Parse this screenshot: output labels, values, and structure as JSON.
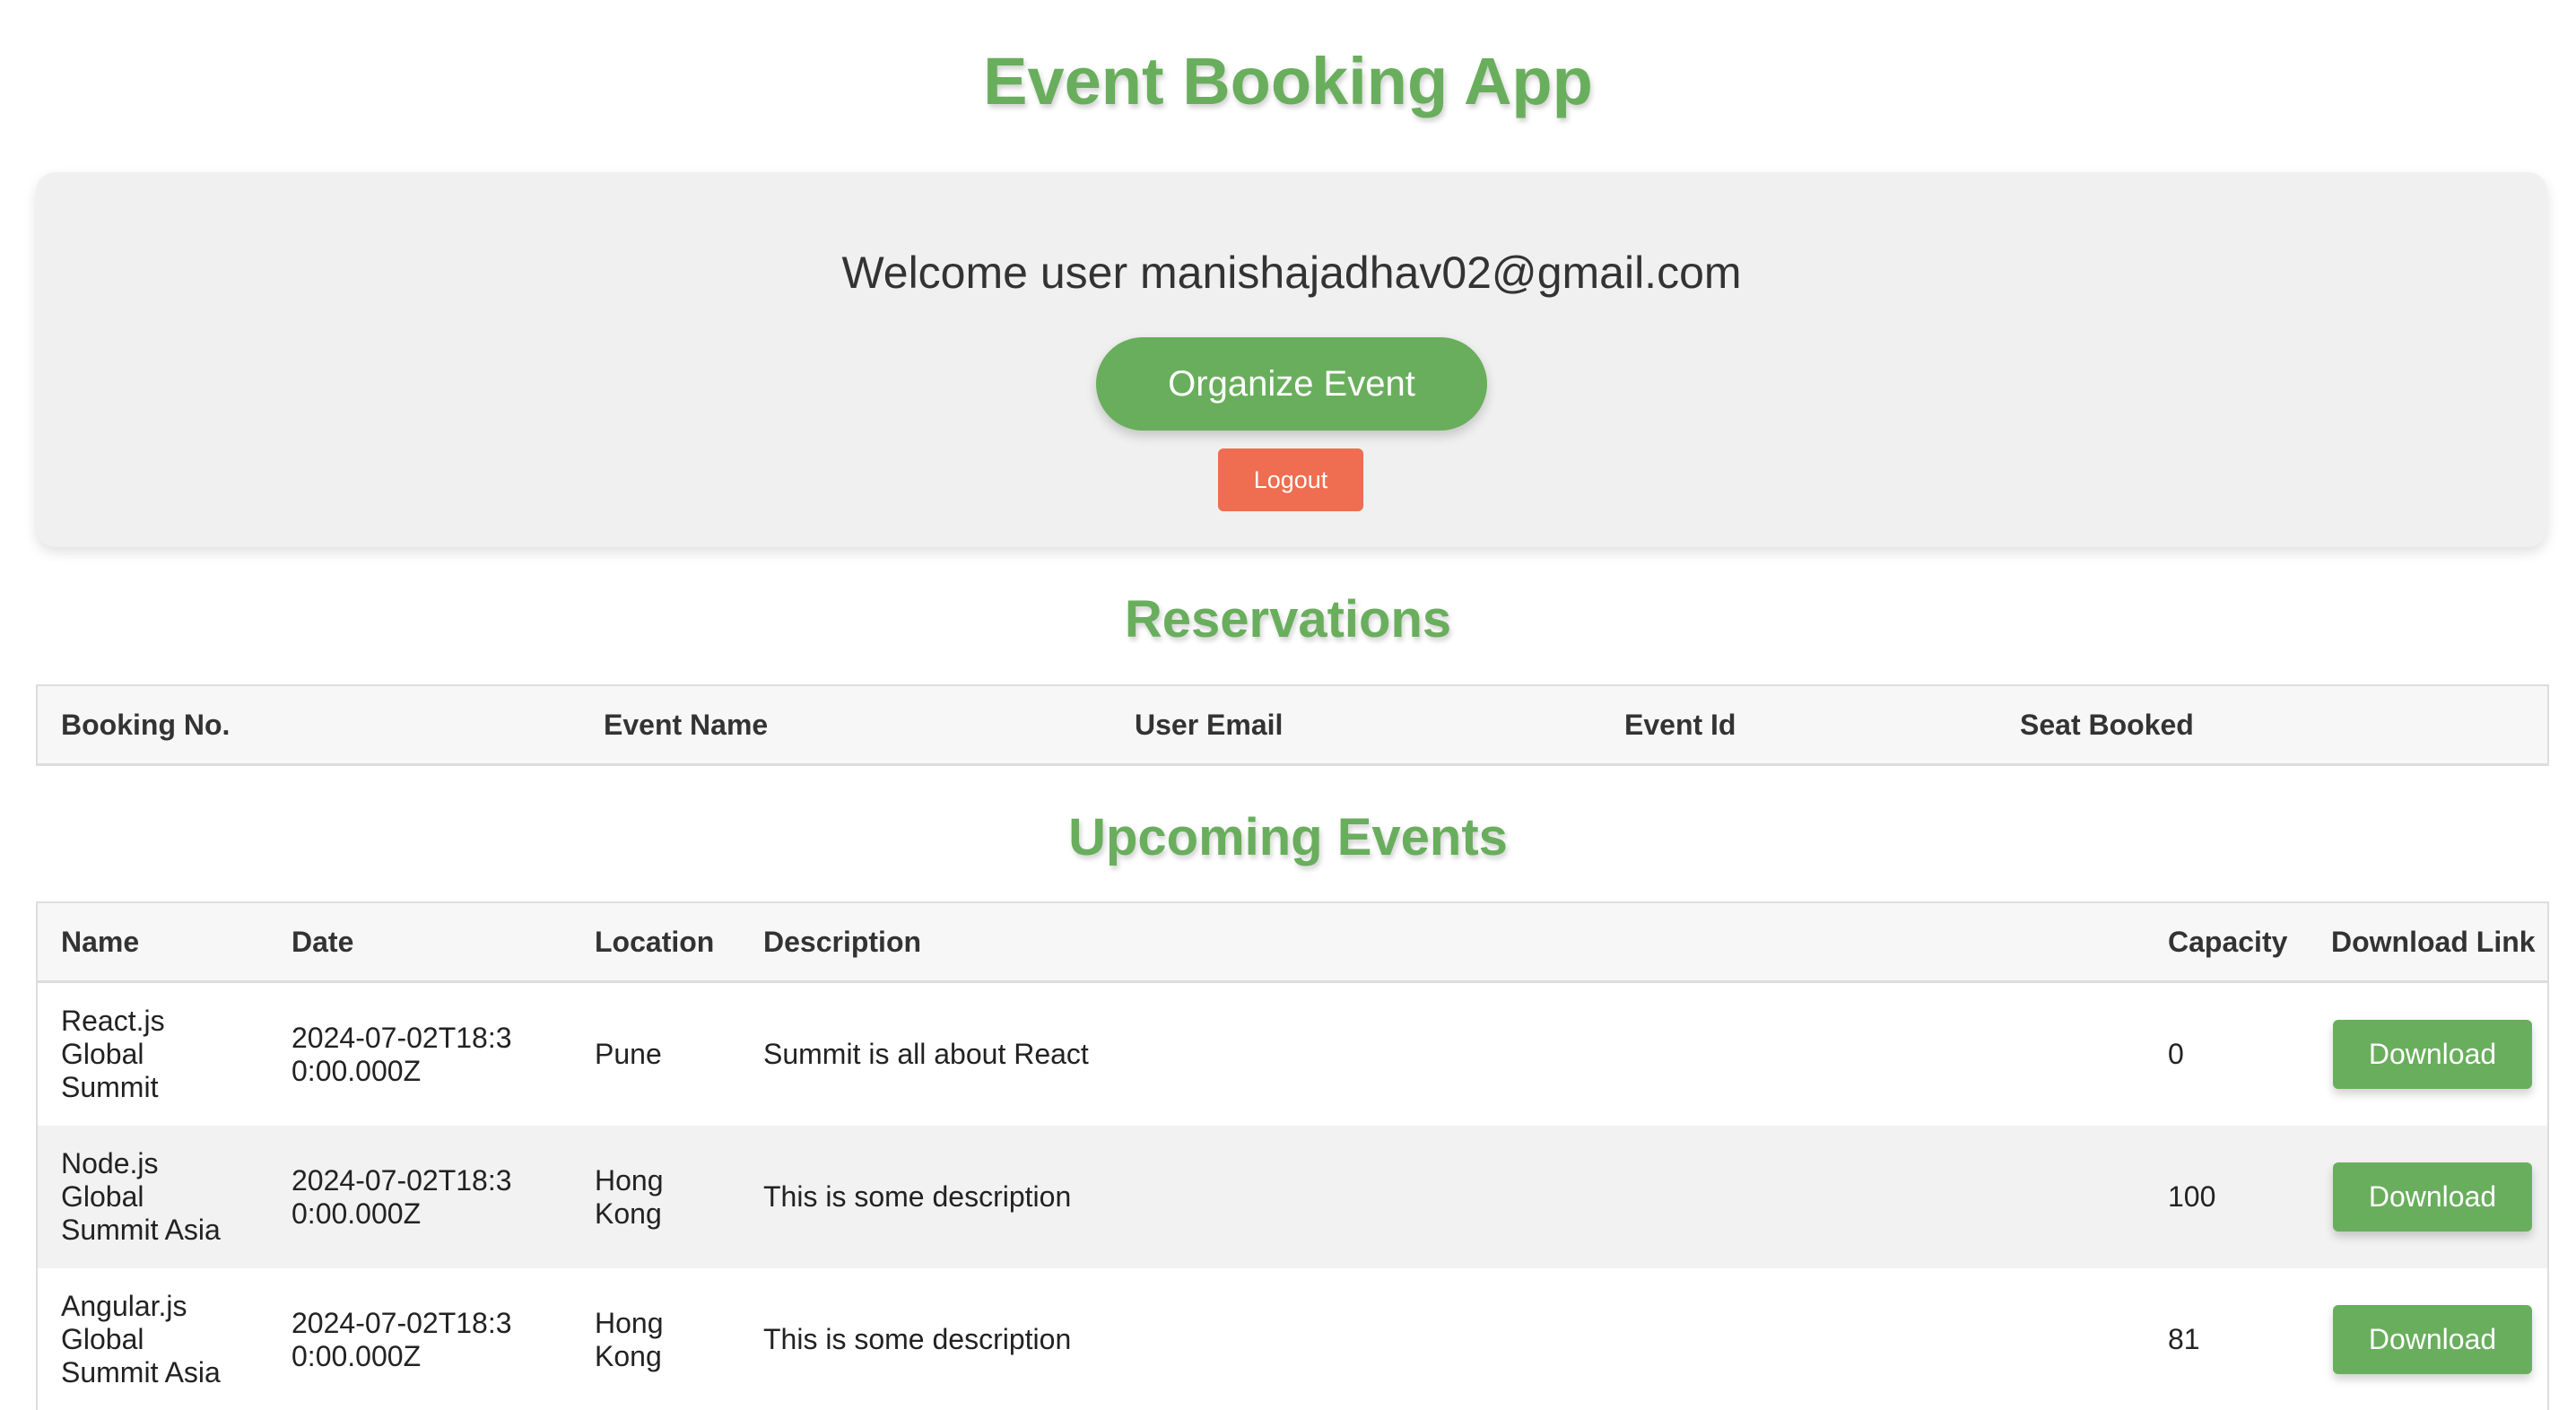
{
  "app": {
    "title": "Event Booking App"
  },
  "welcome": {
    "text": "Welcome user manishajadhav02@gmail.com",
    "organize_label": "Organize Event",
    "logout_label": "Logout"
  },
  "reservations": {
    "title": "Reservations",
    "columns": [
      "Booking No.",
      "Event Name",
      "User Email",
      "Event Id",
      "Seat Booked"
    ],
    "rows": []
  },
  "upcoming": {
    "title": "Upcoming Events",
    "columns": [
      "Name",
      "Date",
      "Location",
      "Description",
      "Capacity",
      "Download Link"
    ],
    "rows": [
      {
        "name": "React.js Global Summit",
        "date": "2024-07-02T18:30:00.000Z",
        "location": "Pune",
        "description": "Summit is all about React",
        "capacity": "0",
        "download_label": "Download"
      },
      {
        "name": "Node.js Global Summit Asia",
        "date": "2024-07-02T18:30:00.000Z",
        "location": "Hong Kong",
        "description": "This is some description",
        "capacity": "100",
        "download_label": "Download"
      },
      {
        "name": "Angular.js Global Summit Asia",
        "date": "2024-07-02T18:30:00.000Z",
        "location": "Hong Kong",
        "description": "This is some description",
        "capacity": "81",
        "download_label": "Download"
      }
    ]
  },
  "colors": {
    "accent_green": "#69ae5c",
    "logout_red": "#ef6d50",
    "card_bg": "#f0f0f0"
  }
}
